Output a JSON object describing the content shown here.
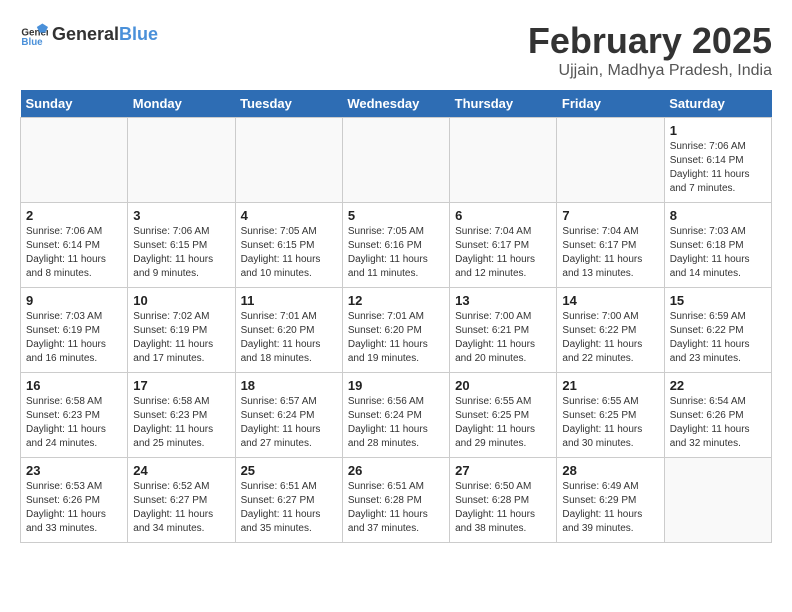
{
  "header": {
    "logo_general": "General",
    "logo_blue": "Blue",
    "title": "February 2025",
    "subtitle": "Ujjain, Madhya Pradesh, India"
  },
  "calendar": {
    "days_of_week": [
      "Sunday",
      "Monday",
      "Tuesday",
      "Wednesday",
      "Thursday",
      "Friday",
      "Saturday"
    ],
    "weeks": [
      [
        {
          "day": "",
          "info": ""
        },
        {
          "day": "",
          "info": ""
        },
        {
          "day": "",
          "info": ""
        },
        {
          "day": "",
          "info": ""
        },
        {
          "day": "",
          "info": ""
        },
        {
          "day": "",
          "info": ""
        },
        {
          "day": "1",
          "info": "Sunrise: 7:06 AM\nSunset: 6:14 PM\nDaylight: 11 hours and 7 minutes."
        }
      ],
      [
        {
          "day": "2",
          "info": "Sunrise: 7:06 AM\nSunset: 6:14 PM\nDaylight: 11 hours and 8 minutes."
        },
        {
          "day": "3",
          "info": "Sunrise: 7:06 AM\nSunset: 6:15 PM\nDaylight: 11 hours and 9 minutes."
        },
        {
          "day": "4",
          "info": "Sunrise: 7:05 AM\nSunset: 6:15 PM\nDaylight: 11 hours and 10 minutes."
        },
        {
          "day": "5",
          "info": "Sunrise: 7:05 AM\nSunset: 6:16 PM\nDaylight: 11 hours and 11 minutes."
        },
        {
          "day": "6",
          "info": "Sunrise: 7:04 AM\nSunset: 6:17 PM\nDaylight: 11 hours and 12 minutes."
        },
        {
          "day": "7",
          "info": "Sunrise: 7:04 AM\nSunset: 6:17 PM\nDaylight: 11 hours and 13 minutes."
        },
        {
          "day": "8",
          "info": "Sunrise: 7:03 AM\nSunset: 6:18 PM\nDaylight: 11 hours and 14 minutes."
        }
      ],
      [
        {
          "day": "9",
          "info": "Sunrise: 7:03 AM\nSunset: 6:19 PM\nDaylight: 11 hours and 16 minutes."
        },
        {
          "day": "10",
          "info": "Sunrise: 7:02 AM\nSunset: 6:19 PM\nDaylight: 11 hours and 17 minutes."
        },
        {
          "day": "11",
          "info": "Sunrise: 7:01 AM\nSunset: 6:20 PM\nDaylight: 11 hours and 18 minutes."
        },
        {
          "day": "12",
          "info": "Sunrise: 7:01 AM\nSunset: 6:20 PM\nDaylight: 11 hours and 19 minutes."
        },
        {
          "day": "13",
          "info": "Sunrise: 7:00 AM\nSunset: 6:21 PM\nDaylight: 11 hours and 20 minutes."
        },
        {
          "day": "14",
          "info": "Sunrise: 7:00 AM\nSunset: 6:22 PM\nDaylight: 11 hours and 22 minutes."
        },
        {
          "day": "15",
          "info": "Sunrise: 6:59 AM\nSunset: 6:22 PM\nDaylight: 11 hours and 23 minutes."
        }
      ],
      [
        {
          "day": "16",
          "info": "Sunrise: 6:58 AM\nSunset: 6:23 PM\nDaylight: 11 hours and 24 minutes."
        },
        {
          "day": "17",
          "info": "Sunrise: 6:58 AM\nSunset: 6:23 PM\nDaylight: 11 hours and 25 minutes."
        },
        {
          "day": "18",
          "info": "Sunrise: 6:57 AM\nSunset: 6:24 PM\nDaylight: 11 hours and 27 minutes."
        },
        {
          "day": "19",
          "info": "Sunrise: 6:56 AM\nSunset: 6:24 PM\nDaylight: 11 hours and 28 minutes."
        },
        {
          "day": "20",
          "info": "Sunrise: 6:55 AM\nSunset: 6:25 PM\nDaylight: 11 hours and 29 minutes."
        },
        {
          "day": "21",
          "info": "Sunrise: 6:55 AM\nSunset: 6:25 PM\nDaylight: 11 hours and 30 minutes."
        },
        {
          "day": "22",
          "info": "Sunrise: 6:54 AM\nSunset: 6:26 PM\nDaylight: 11 hours and 32 minutes."
        }
      ],
      [
        {
          "day": "23",
          "info": "Sunrise: 6:53 AM\nSunset: 6:26 PM\nDaylight: 11 hours and 33 minutes."
        },
        {
          "day": "24",
          "info": "Sunrise: 6:52 AM\nSunset: 6:27 PM\nDaylight: 11 hours and 34 minutes."
        },
        {
          "day": "25",
          "info": "Sunrise: 6:51 AM\nSunset: 6:27 PM\nDaylight: 11 hours and 35 minutes."
        },
        {
          "day": "26",
          "info": "Sunrise: 6:51 AM\nSunset: 6:28 PM\nDaylight: 11 hours and 37 minutes."
        },
        {
          "day": "27",
          "info": "Sunrise: 6:50 AM\nSunset: 6:28 PM\nDaylight: 11 hours and 38 minutes."
        },
        {
          "day": "28",
          "info": "Sunrise: 6:49 AM\nSunset: 6:29 PM\nDaylight: 11 hours and 39 minutes."
        },
        {
          "day": "",
          "info": ""
        }
      ]
    ]
  }
}
